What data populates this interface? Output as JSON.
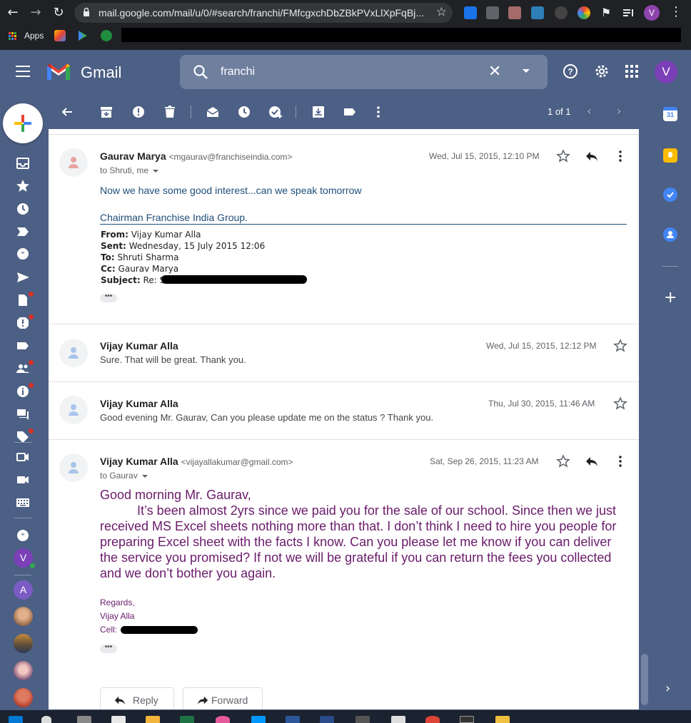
{
  "browser": {
    "url": "mail.google.com/mail/u/0/#search/franchi/FMfcgxchDbZBkPVxLlXpFqBj...",
    "bookmarks": {
      "apps_label": "Apps"
    },
    "profile_initial": "V"
  },
  "header": {
    "app_name": "Gmail",
    "search_query": "franchi",
    "account_initial": "V"
  },
  "toolbar": {
    "pager": "1 of 1"
  },
  "rail": {
    "avatars": [
      {
        "initial": "V",
        "color": "#7b3fb8"
      },
      {
        "initial": "A",
        "color": "#7b5cc4"
      }
    ]
  },
  "messages": [
    {
      "sender": "Gaurav Marya",
      "email": "<mgaurav@franchiseindia.com>",
      "recipients": "to Shruti, me",
      "date": "Wed, Jul 15, 2015, 12:10 PM",
      "body": "Now we have some good interest...can we speak tomorrow",
      "signature": "Chairman Franchise India Group.",
      "forwarded": {
        "from_label": "From:",
        "from": "Vijay Kumar Alla",
        "sent_label": "Sent:",
        "sent": "Wednesday, 15 July 2015 12:06",
        "to_label": "To:",
        "to": "Shruti Sharma",
        "cc_label": "Cc:",
        "cc": "Gaurav Marya",
        "subject_label": "Subject:",
        "subject_visible": "Re: S"
      },
      "expand": "•••"
    },
    {
      "sender": "Vijay Kumar Alla",
      "date": "Wed, Jul 15, 2015, 12:12 PM",
      "snippet": "Sure. That will be great. Thank you."
    },
    {
      "sender": "Vijay Kumar Alla",
      "date": "Thu, Jul 30, 2015, 11:46 AM",
      "snippet": "Good evening Mr. Gaurav, Can you please update me on the status ? Thank you."
    },
    {
      "sender": "Vijay Kumar Alla",
      "email": "<vijayallakumar@gmail.com>",
      "recipients": "to Gaurav",
      "date": "Sat, Sep 26, 2015, 11:23 AM",
      "greeting": "Good morning Mr. Gaurav,",
      "body": "It’s been almost 2yrs since we paid you for the sale of our school. Since then we just received MS Excel sheets nothing more than that. I don’t think I need to hire you people for preparing Excel sheet with the facts I know. Can you please let me know if you can deliver the service you promised? If not we will be grateful if you can return the fees you collected and we don’t bother you again.",
      "regards": "Regards,",
      "name": "Vijay Alla",
      "cell_label": "Cell:",
      "expand": "•••"
    }
  ],
  "actions": {
    "reply": "Reply",
    "forward": "Forward"
  },
  "colors": {
    "theme_bg": "#4c5f84",
    "body_purple": "#6a1b6a",
    "body_blue": "#1f4e79"
  }
}
